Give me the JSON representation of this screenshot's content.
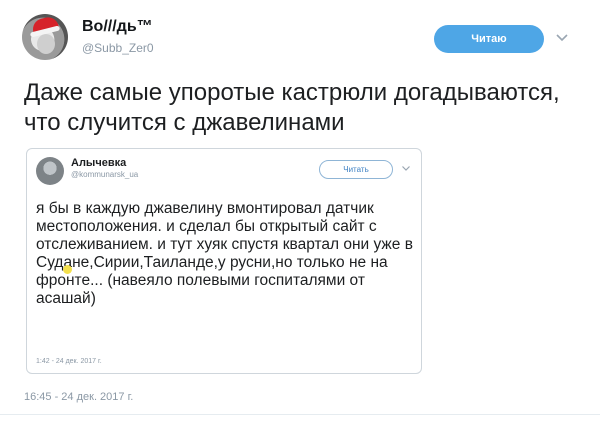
{
  "author": {
    "display_name": "Во///дь™",
    "handle": "@Subb_Zer0"
  },
  "follow_label": "Читаю",
  "tweet_text": "Даже самые упоротые кастрюли догадываются, что случится с джавелинами",
  "quoted": {
    "display_name": "Алычевка",
    "handle": "@kommunarsk_ua",
    "follow_label": "Читать",
    "text": "я бы в каждую джавелину вмонтировал датчик местоположения. и сделал бы открытый сайт с отслеживанием. и тут хуяк спустя квартал они уже в Судане,Сирии,Таиланде,у русни,но только не на фронте... (навеяло полевыми госпиталями от асашай)",
    "timestamp": "1:42 - 24 дек. 2017 г."
  },
  "timestamp": "16:45 - 24 дек. 2017 г.",
  "colors": {
    "accent": "#4ea6e6",
    "muted": "#8b98a5"
  },
  "icons": {
    "menu_caret": "chevron-down-icon"
  }
}
